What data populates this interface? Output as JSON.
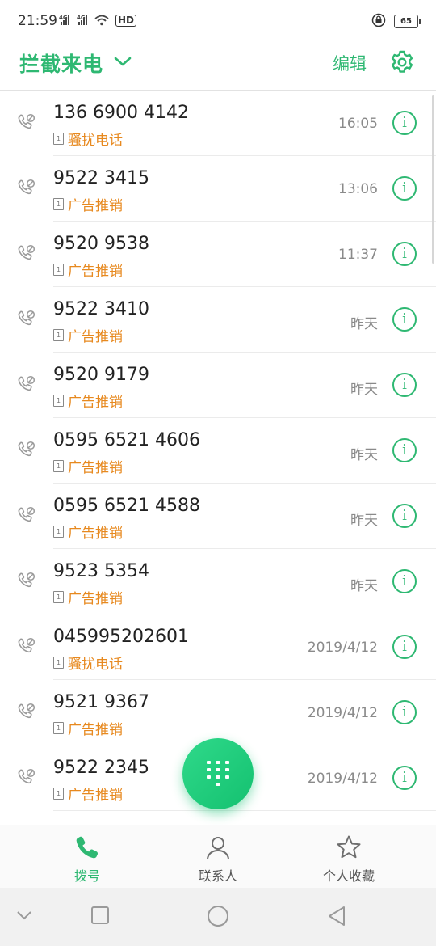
{
  "status_bar": {
    "time": "21:59",
    "signal_text": "4G 4G",
    "hd_label": "HD",
    "battery": "65"
  },
  "header": {
    "title": "拦截来电",
    "edit_label": "编辑"
  },
  "calls": [
    {
      "number": "136 6900 4142",
      "tag": "骚扰电话",
      "time": "16:05"
    },
    {
      "number": "9522 3415",
      "tag": "广告推销",
      "time": "13:06"
    },
    {
      "number": "9520 9538",
      "tag": "广告推销",
      "time": "11:37"
    },
    {
      "number": "9522 3410",
      "tag": "广告推销",
      "time": "昨天"
    },
    {
      "number": "9520 9179",
      "tag": "广告推销",
      "time": "昨天"
    },
    {
      "number": "0595 6521 4606",
      "tag": "广告推销",
      "time": "昨天"
    },
    {
      "number": "0595 6521 4588",
      "tag": "广告推销",
      "time": "昨天"
    },
    {
      "number": "9523 5354",
      "tag": "广告推销",
      "time": "昨天"
    },
    {
      "number": "045995202601",
      "tag": "骚扰电话",
      "time": "2019/4/12"
    },
    {
      "number": "9521 9367",
      "tag": "广告推销",
      "time": "2019/4/12"
    },
    {
      "number": "9522 2345",
      "tag": "广告推销",
      "time": "2019/4/12"
    }
  ],
  "sim_label": "1",
  "info_glyph": "i",
  "tabs": [
    {
      "label": "拨号",
      "icon": "phone-icon",
      "active": true
    },
    {
      "label": "联系人",
      "icon": "person-icon",
      "active": false
    },
    {
      "label": "个人收藏",
      "icon": "star-icon",
      "active": false
    }
  ],
  "colors": {
    "accent": "#2eb872",
    "tag": "#e7891f",
    "time_text": "#8a8a8a"
  }
}
